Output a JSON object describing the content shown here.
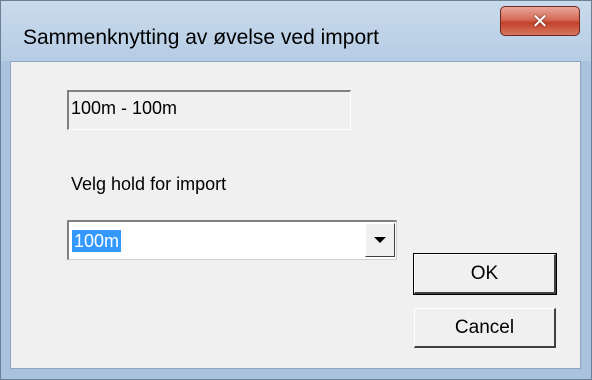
{
  "window": {
    "title": "Sammenknytting av øvelse ved import",
    "close_icon": "close-x-icon"
  },
  "dialog": {
    "event_field_value": "100m - 100m",
    "team_label": "Velg hold for import",
    "team_select": {
      "value": "100m",
      "icon": "chevron-down-icon"
    },
    "ok_label": "OK",
    "cancel_label": "Cancel"
  },
  "colors": {
    "selection_highlight": "#3399ff",
    "close_button": "#c2412b",
    "titlebar": "#b6cce4"
  }
}
